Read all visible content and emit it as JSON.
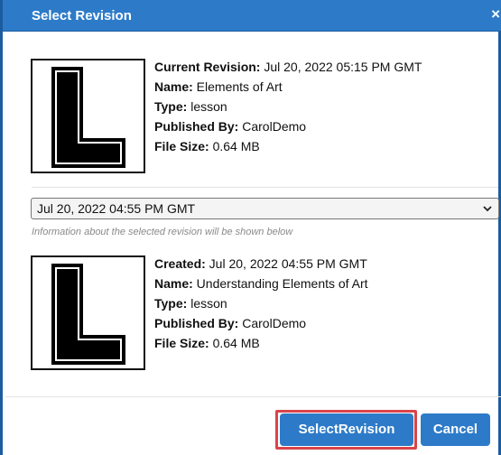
{
  "dialog": {
    "title": "Select Revision",
    "close_label": "×"
  },
  "current": {
    "revision_label": "Current Revision:",
    "revision_value": " Jul 20, 2022 05:15 PM GMT",
    "name_label": "Name:",
    "name_value": " Elements of Art",
    "type_label": "Type:",
    "type_value": " lesson",
    "published_label": "Published By:",
    "published_value": " CarolDemo",
    "size_label": "File Size:",
    "size_value": " 0.64 MB",
    "thumbnail_letter": "L"
  },
  "revision_select": {
    "selected": "Jul 20, 2022 04:55 PM GMT",
    "hint": "Information about the selected revision will be shown below"
  },
  "selected": {
    "created_label": "Created:",
    "created_value": " Jul 20, 2022 04:55 PM GMT",
    "name_label": "Name:",
    "name_value": " Understanding Elements of Art",
    "type_label": "Type:",
    "type_value": " lesson",
    "published_label": "Published By:",
    "published_value": " CarolDemo",
    "size_label": "File Size:",
    "size_value": " 0.64 MB",
    "thumbnail_letter": "L"
  },
  "buttons": {
    "select_label": "SelectRevision",
    "cancel_label": "Cancel"
  },
  "colors": {
    "header": "#2d7bc8",
    "button": "#2d7bc8",
    "highlight": "#d9444a"
  }
}
